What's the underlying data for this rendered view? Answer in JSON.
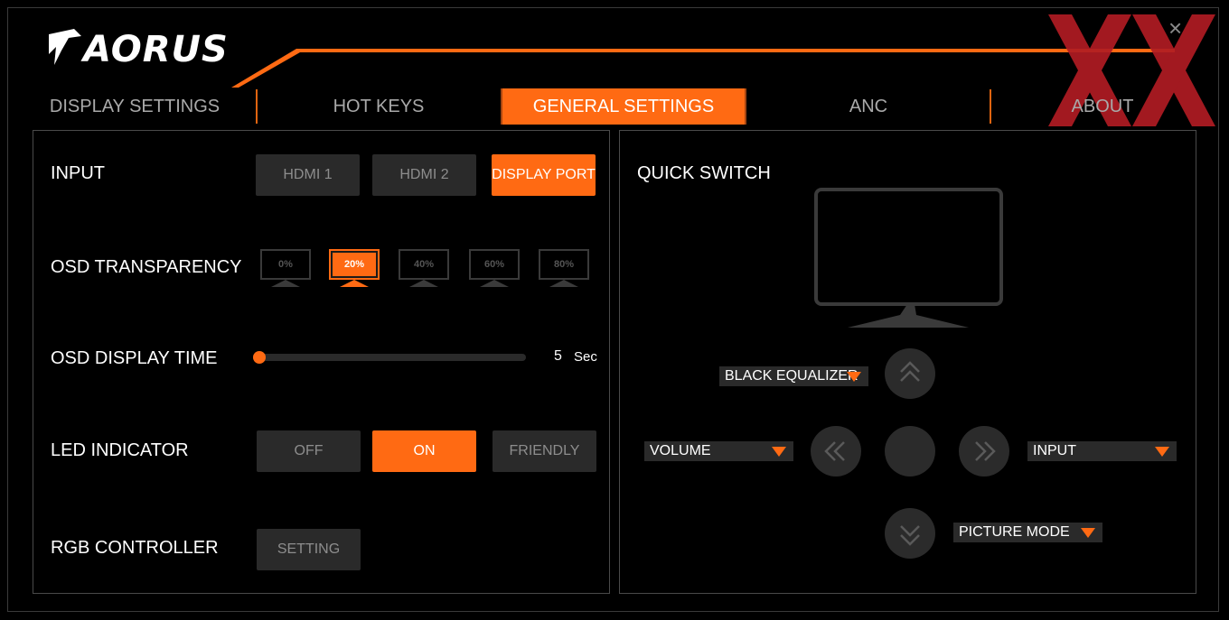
{
  "brand": {
    "logo_text": "AORUS"
  },
  "window": {
    "close_glyph": "×",
    "accent_color": "#ff6a13"
  },
  "tabs": [
    {
      "label": "DISPLAY SETTINGS"
    },
    {
      "label": "HOT KEYS"
    },
    {
      "label": "GENERAL SETTINGS",
      "active": true
    },
    {
      "label": "ANC"
    },
    {
      "label": "ABOUT"
    }
  ],
  "general": {
    "input": {
      "label": "INPUT",
      "options": [
        "HDMI 1",
        "HDMI 2",
        "DISPLAY PORT"
      ],
      "selected": "DISPLAY PORT"
    },
    "osd_transparency": {
      "label": "OSD TRANSPARENCY",
      "options": [
        "0%",
        "20%",
        "40%",
        "60%",
        "80%"
      ],
      "selected": "20%"
    },
    "osd_display_time": {
      "label": "OSD DISPLAY TIME",
      "value": "5",
      "unit": "Sec",
      "fraction": 0.0
    },
    "led_indicator": {
      "label": "LED INDICATOR",
      "options": [
        "OFF",
        "ON",
        "FRIENDLY"
      ],
      "selected": "ON"
    },
    "rgb_controller": {
      "label": "RGB CONTROLLER",
      "button": "SETTING"
    }
  },
  "quick_switch": {
    "title": "QUICK SWITCH",
    "up": "BLACK EQUALIZER",
    "left": "VOLUME",
    "right": "INPUT",
    "down": "PICTURE MODE"
  }
}
